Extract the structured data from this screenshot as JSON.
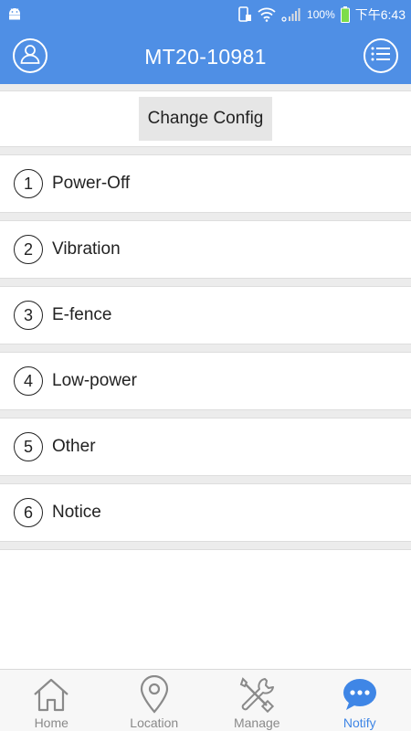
{
  "status_bar": {
    "battery": "100%",
    "time": "下午6:43"
  },
  "header": {
    "title": "MT20-10981",
    "left_icon": "user-avatar-icon",
    "right_icon": "list-menu-icon"
  },
  "config": {
    "button_label": "Change Config"
  },
  "items": [
    {
      "num": "1",
      "label": "Power-Off"
    },
    {
      "num": "2",
      "label": "Vibration"
    },
    {
      "num": "3",
      "label": "E-fence"
    },
    {
      "num": "4",
      "label": "Low-power"
    },
    {
      "num": "5",
      "label": "Other"
    },
    {
      "num": "6",
      "label": "Notice"
    }
  ],
  "nav": [
    {
      "label": "Home",
      "icon": "home-icon",
      "active": false
    },
    {
      "label": "Location",
      "icon": "location-pin-icon",
      "active": false
    },
    {
      "label": "Manage",
      "icon": "tools-icon",
      "active": false
    },
    {
      "label": "Notify",
      "icon": "chat-bubble-icon",
      "active": true
    }
  ],
  "colors": {
    "primary": "#4f8fe5",
    "active_nav": "#3f86e6",
    "gap": "#ececec"
  }
}
